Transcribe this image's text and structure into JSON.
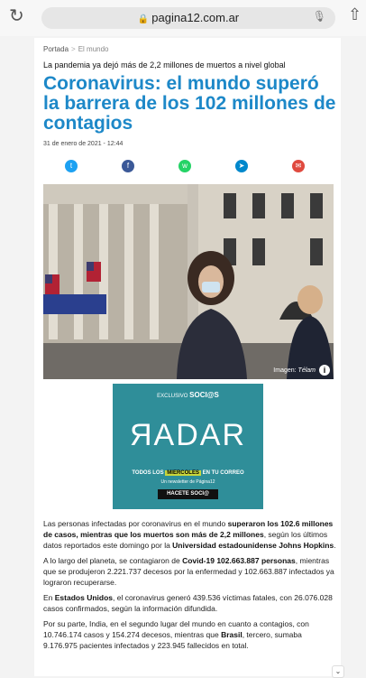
{
  "browser": {
    "url": "pagina12.com.ar",
    "lock_icon": "lock-icon",
    "mic_icon": "mic-icon",
    "reload_icon": "reload-icon",
    "share_icon": "share-icon"
  },
  "article": {
    "breadcrumb": {
      "home": "Portada",
      "separator": ">",
      "section": "El mundo"
    },
    "kicker": "La pandemia ya dejó más de 2,2 millones de muertos a nivel global",
    "headline": "Coronavirus: el mundo superó la barrera de los 102 millones de contagios",
    "date": "31 de enero de 2021 - 12:44",
    "image_credit_prefix": "Imagen: ",
    "image_credit_source": "Télam",
    "paragraphs": {
      "p1": {
        "a": "Las personas infectadas por coronavirus en el mundo ",
        "b": "superaron los 102.6 millones de casos, mientras que los muertos son más de 2,2 millones",
        "c": ", según los últimos datos reportados este domingo por la ",
        "d": "Universidad estadounidense Johns Hopkins",
        "e": "."
      },
      "p2": {
        "a": "A lo largo del planeta, se contagiaron de ",
        "b": "Covid-19 102.663.887 personas",
        "c": ", mientras que se produjeron 2.221.737 decesos por la enfermedad y 102.663.887 infectados ya lograron recuperarse."
      },
      "p3": {
        "a": "En ",
        "b": "Estados Unidos",
        "c": ", el coronavirus generó 439.536 víctimas fatales, con 26.076.028 casos confirmados, según la información difundida."
      },
      "p4": {
        "a": "Por su parte, India, en el segundo lugar del mundo en cuanto a contagios, con 10.746.174 casos y 154.274 decesos, mientras que ",
        "b": "Brasil",
        "c": ", tercero, sumaba 9.176.975 pacientes infectados y 223.945 fallecidos en total."
      }
    }
  },
  "social": [
    {
      "name": "twitter",
      "color": "#1da1f2",
      "glyph": "t"
    },
    {
      "name": "facebook",
      "color": "#3b5998",
      "glyph": "f"
    },
    {
      "name": "whatsapp",
      "color": "#25d366",
      "glyph": "w"
    },
    {
      "name": "telegram",
      "color": "#0088cc",
      "glyph": "➤"
    },
    {
      "name": "email",
      "color": "#e04a3f",
      "glyph": "✉"
    }
  ],
  "ad": {
    "exclusive_prefix": "EXCLUSIVO",
    "exclusive_brand": "SOCI@S",
    "logo": "ЯADAR",
    "todos_pre": "TODOS LOS ",
    "todos_hl": "MIERCOLES",
    "todos_post": " EN TU CORREO",
    "newsletter": "Un newsletter de Página12",
    "button": "HACETE SOCI@"
  }
}
